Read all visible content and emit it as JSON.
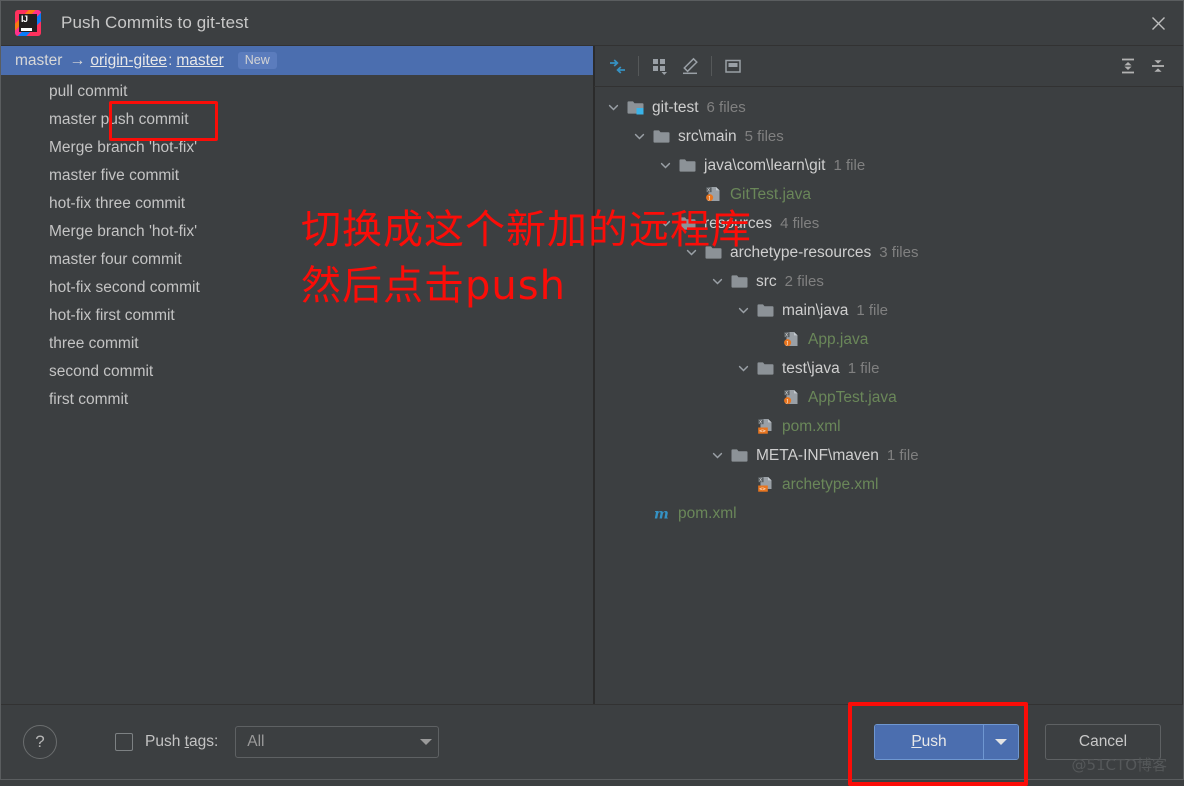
{
  "window": {
    "title": "Push Commits to git-test",
    "logo_icon": "intellij-idea-logo",
    "close_icon": "close-icon"
  },
  "branch_row": {
    "source": "master",
    "arrow": "→",
    "remote": "origin-gitee",
    "separator": ":",
    "target": "master",
    "badge": "New"
  },
  "commits": [
    {
      "message": "pull commit"
    },
    {
      "message": "master push commit"
    },
    {
      "message": "Merge branch 'hot-fix'"
    },
    {
      "message": "master five commit"
    },
    {
      "message": "hot-fix three commit"
    },
    {
      "message": "Merge branch 'hot-fix'"
    },
    {
      "message": "master four commit"
    },
    {
      "message": "hot-fix second commit"
    },
    {
      "message": "hot-fix first commit"
    },
    {
      "message": "three commit"
    },
    {
      "message": "second commit"
    },
    {
      "message": "first commit"
    }
  ],
  "file_toolbar": {
    "buttons": [
      {
        "name": "show-diff-icon",
        "title": ""
      },
      {
        "name": "group-by-icon",
        "title": ""
      },
      {
        "name": "edit-icon",
        "title": ""
      },
      {
        "name": "preview-icon",
        "title": ""
      },
      {
        "name": "expand-all-icon",
        "title": ""
      },
      {
        "name": "collapse-all-icon",
        "title": ""
      }
    ]
  },
  "file_tree": [
    {
      "depth": 0,
      "twisty": "down",
      "icon": "module-folder-icon",
      "label": "git-test",
      "count": "6 files",
      "green": false
    },
    {
      "depth": 1,
      "twisty": "down",
      "icon": "folder-icon",
      "label": "src\\main",
      "count": "5 files",
      "green": false
    },
    {
      "depth": 2,
      "twisty": "down",
      "icon": "folder-icon",
      "label": "java\\com\\learn\\git",
      "count": "1 file",
      "green": false
    },
    {
      "depth": 3,
      "twisty": "none",
      "icon": "java-file-icon",
      "label": "GitTest.java",
      "count": "",
      "green": true
    },
    {
      "depth": 2,
      "twisty": "down",
      "icon": "folder-icon",
      "label": "resources",
      "count": "4 files",
      "green": false
    },
    {
      "depth": 3,
      "twisty": "down",
      "icon": "folder-icon",
      "label": "archetype-resources",
      "count": "3 files",
      "green": false
    },
    {
      "depth": 4,
      "twisty": "down",
      "icon": "folder-icon",
      "label": "src",
      "count": "2 files",
      "green": false
    },
    {
      "depth": 5,
      "twisty": "down",
      "icon": "folder-icon",
      "label": "main\\java",
      "count": "1 file",
      "green": false
    },
    {
      "depth": 6,
      "twisty": "none",
      "icon": "java-file-icon",
      "label": "App.java",
      "count": "",
      "green": true
    },
    {
      "depth": 5,
      "twisty": "down",
      "icon": "folder-icon",
      "label": "test\\java",
      "count": "1 file",
      "green": false
    },
    {
      "depth": 6,
      "twisty": "none",
      "icon": "java-file-icon",
      "label": "AppTest.java",
      "count": "",
      "green": true
    },
    {
      "depth": 5,
      "twisty": "none",
      "icon": "xml-file-icon",
      "label": "pom.xml",
      "count": "",
      "green": true
    },
    {
      "depth": 4,
      "twisty": "down",
      "icon": "folder-icon",
      "label": "META-INF\\maven",
      "count": "1 file",
      "green": false
    },
    {
      "depth": 5,
      "twisty": "none",
      "icon": "xml-file-icon",
      "label": "archetype.xml",
      "count": "",
      "green": true
    },
    {
      "depth": 1,
      "twisty": "none",
      "icon": "maven-file-icon",
      "label": "pom.xml",
      "count": "",
      "green": true
    }
  ],
  "annotation": {
    "line1": "切换成这个新加的远程库",
    "line2": "然后点击push"
  },
  "footer": {
    "help_label": "?",
    "push_tags_label_pre": "Push ",
    "push_tags_label_mnemonic": "t",
    "push_tags_label_post": "ags:",
    "push_tags_checked": false,
    "tags_value": "All",
    "tags_options": [
      "All"
    ],
    "push_label_pre": "",
    "push_label_mnemonic": "P",
    "push_label_post": "ush",
    "cancel_label": "Cancel"
  },
  "watermark": "@51CTO博客",
  "colors": {
    "window_bg": "#3c3f41",
    "selection_blue": "#4b6eaf",
    "annotation_red": "#fb0d08",
    "file_green": "#6a8759",
    "text": "#c4c4c4"
  }
}
